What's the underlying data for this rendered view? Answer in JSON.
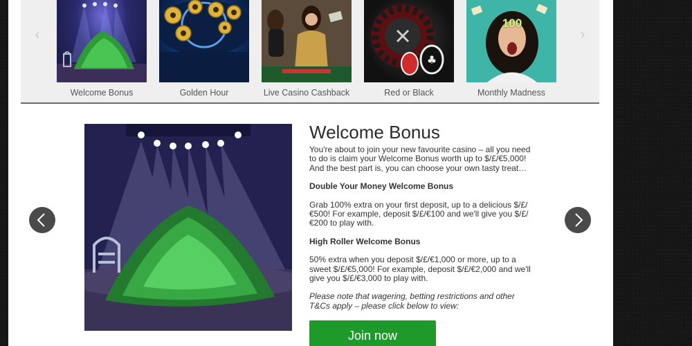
{
  "thumbnails": [
    {
      "caption": "Welcome Bonus"
    },
    {
      "caption": "Golden Hour"
    },
    {
      "caption": "Live Casino Cashback"
    },
    {
      "caption": "Red or Black"
    },
    {
      "caption": "Monthly Madness",
      "image_text": "100"
    }
  ],
  "strip_nav": {
    "prev_icon": "chevron-left-icon",
    "next_icon": "chevron-right-icon"
  },
  "feature": {
    "title": "Welcome Bonus",
    "intro": "You're about to join your new favourite casino – all you need to do is claim your Welcome Bonus worth up to $/£/€5,000! And the best part is, you can choose your own tasty treat…",
    "section1_heading": "Double Your Money Welcome Bonus",
    "section1_text": "Grab 100% extra on your first deposit, up to a delicious $/£/€500! For example, deposit $/£/€100 and we'll give you $/£/€200 to play with.",
    "section2_heading": "High Roller Welcome Bonus",
    "section2_text": "50% extra when you deposit $/£/€1,000 or more, up to a sweet $/£/€5,000! For example, deposit $/£/€2,000 and we'll give you $/£/€3,000 to play with.",
    "note": "Please note that wagering, betting restrictions and other T&Cs apply – please click below to view:",
    "cta_label": "Join now"
  },
  "colors": {
    "cta": "#1e9a2a",
    "nav_button": "#4a4a4a",
    "strip_bg": "#efefef"
  }
}
